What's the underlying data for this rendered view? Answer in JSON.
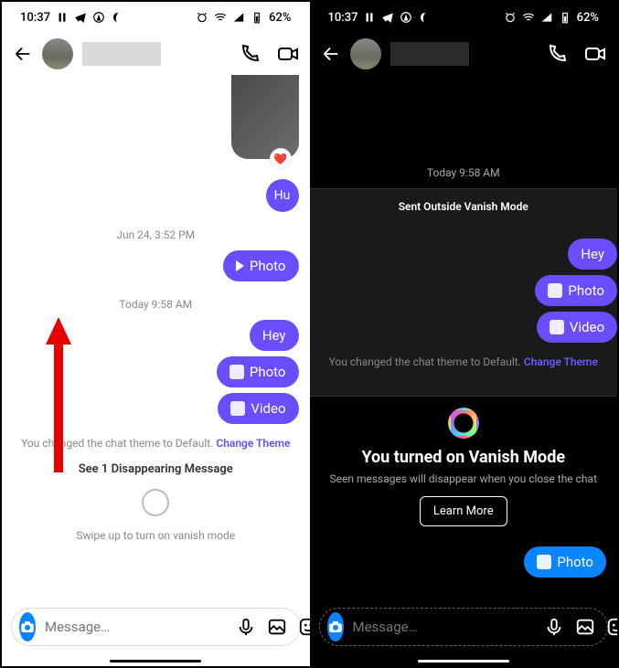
{
  "statusbar": {
    "time": "10:37",
    "battery": "62%"
  },
  "light": {
    "messages": {
      "hu": "Hu",
      "ts1": "Jun 24, 3:52 PM",
      "photo1": "Photo",
      "ts2": "Today 9:58 AM",
      "hey": "Hey",
      "photo2": "Photo",
      "video": "Video"
    },
    "theme_change": "You changed the chat theme to Default. ",
    "theme_link": "Change Theme",
    "disappearing": "See 1 Disappearing Message",
    "vanish_hint": "Swipe up to turn on vanish mode",
    "placeholder": "Message…"
  },
  "dark": {
    "ts": "Today 9:58 AM",
    "banner": "Sent Outside Vanish Mode",
    "hey": "Hey",
    "photo": "Photo",
    "video": "Video",
    "theme_change": "You changed the chat theme to Default. ",
    "theme_link": "Change Theme",
    "vanish_title": "You turned on Vanish Mode",
    "vanish_sub": "Seen messages will disappear when you close the chat",
    "learn": "Learn More",
    "photo_blue": "Photo",
    "placeholder": "Message…"
  }
}
